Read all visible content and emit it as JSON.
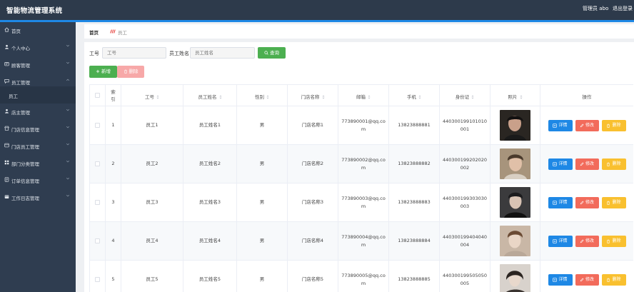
{
  "app": {
    "title": "智能物流管理系统",
    "admin": "管理员 abo",
    "logout": "退出登录"
  },
  "sidebar": {
    "items": [
      {
        "label": "首页",
        "icon": "home-icon"
      },
      {
        "label": "个人中心",
        "icon": "user-icon"
      },
      {
        "label": "顾客管理",
        "icon": "customer-icon"
      },
      {
        "label": "员工管理",
        "icon": "chat-icon"
      },
      {
        "label": "店主管理",
        "icon": "shop-owner-icon"
      },
      {
        "label": "门店信息管理",
        "icon": "store-icon"
      },
      {
        "label": "门店员工管理",
        "icon": "store-staff-icon"
      },
      {
        "label": "部门分类管理",
        "icon": "department-icon"
      },
      {
        "label": "订单信息管理",
        "icon": "order-icon"
      },
      {
        "label": "工作日志管理",
        "icon": "log-icon"
      }
    ],
    "subitem": "员工"
  },
  "breadcrumb": {
    "home": "首页",
    "current": "员工"
  },
  "search": {
    "label_id": "工号",
    "placeholder_id": "工号",
    "label_name": "员工姓名",
    "placeholder_name": "员工姓名",
    "query": "查询"
  },
  "toolbar": {
    "add": "新增",
    "delete": "删除"
  },
  "table": {
    "headers": [
      "索引",
      "工号",
      "员工姓名",
      "性别",
      "门店名称",
      "邮箱",
      "手机",
      "身份证",
      "照片",
      "操作"
    ],
    "actions": {
      "detail": "详情",
      "edit": "修改",
      "delete": "删除"
    },
    "rows": [
      {
        "index": "1",
        "id": "员工1",
        "name": "员工姓名1",
        "gender": "男",
        "store": "门店名称1",
        "email": "773890001@qq.com",
        "phone": "13823888881",
        "idcard": "440300199101010001"
      },
      {
        "index": "2",
        "id": "员工2",
        "name": "员工姓名2",
        "gender": "男",
        "store": "门店名称2",
        "email": "773890002@qq.com",
        "phone": "13823888882",
        "idcard": "440300199202020002"
      },
      {
        "index": "3",
        "id": "员工3",
        "name": "员工姓名3",
        "gender": "男",
        "store": "门店名称3",
        "email": "773890003@qq.com",
        "phone": "13823888883",
        "idcard": "440300199303030003"
      },
      {
        "index": "4",
        "id": "员工4",
        "name": "员工姓名4",
        "gender": "男",
        "store": "门店名称4",
        "email": "773890004@qq.com",
        "phone": "13823888884",
        "idcard": "440300199404040004"
      },
      {
        "index": "5",
        "id": "员工5",
        "name": "员工姓名5",
        "gender": "男",
        "store": "门店名称5",
        "email": "773890005@qq.com",
        "phone": "13823888885",
        "idcard": "440300199505050005"
      }
    ]
  },
  "colors": {
    "topbar": "#2d3a4b",
    "sidebar": "#2f3d50",
    "accent": "#1e88e5",
    "query": "#4caf50",
    "add": "#4caf50",
    "delete": "#f7a8a8",
    "detail": "#1e88e5",
    "edit": "#f26b5b",
    "remove": "#f9c02f"
  }
}
